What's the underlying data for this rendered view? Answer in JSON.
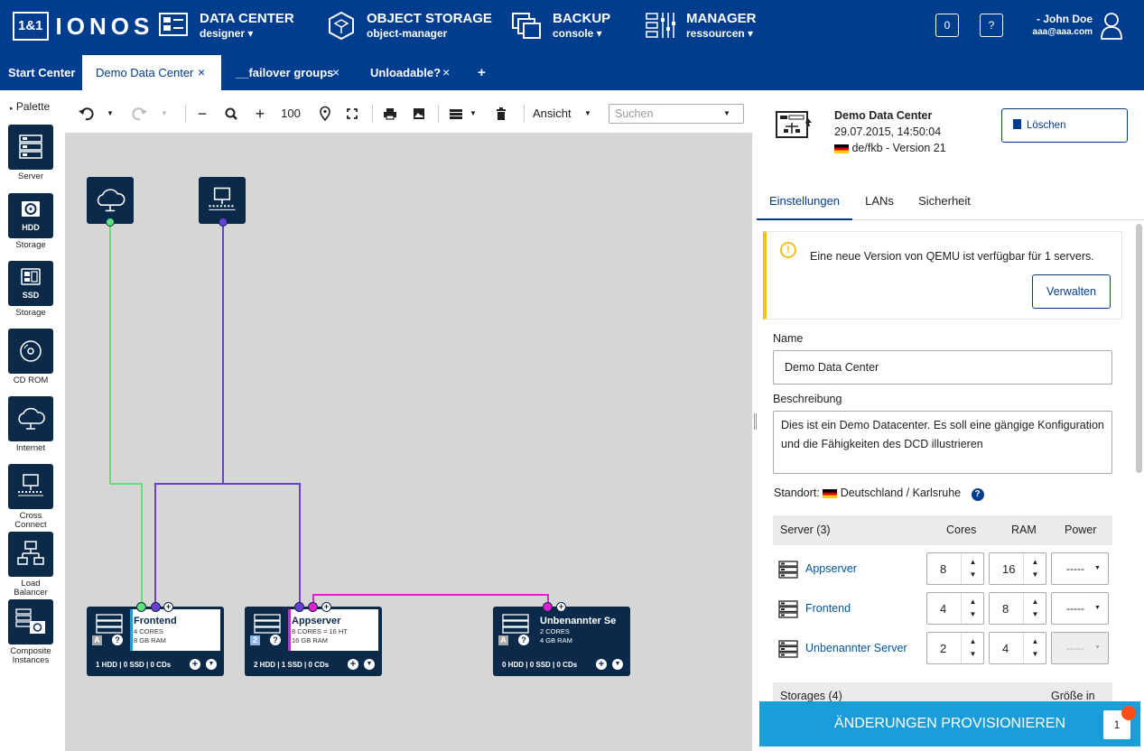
{
  "brand": {
    "box": "1&1",
    "word": "IONOS"
  },
  "nav": [
    {
      "title": "DATA CENTER",
      "sub": "designer ▾"
    },
    {
      "title": "OBJECT STORAGE",
      "sub": "object-manager"
    },
    {
      "title": "BACKUP",
      "sub": "console ▾"
    },
    {
      "title": "MANAGER",
      "sub": "ressourcen ▾"
    }
  ],
  "header": {
    "notifications": "0",
    "help": "?",
    "user_name": "John Doe",
    "user_email": "aaa@aaa.com"
  },
  "tabs": [
    {
      "label": "Start Center"
    },
    {
      "label": "Demo Data Center",
      "close": "×"
    },
    {
      "label": "__failover groups",
      "close": "×"
    },
    {
      "label": "Unloadable?",
      "close": "×"
    },
    {
      "label": "+"
    }
  ],
  "palette": {
    "title": "Palette",
    "items": [
      {
        "label": "Server",
        "badge": ""
      },
      {
        "label": "Storage",
        "badge": "HDD"
      },
      {
        "label": "Storage",
        "badge": "SSD"
      },
      {
        "label": "CD ROM",
        "badge": ""
      },
      {
        "label": "Internet",
        "badge": ""
      },
      {
        "label": "Cross Connect",
        "badge": ""
      },
      {
        "label": "Load Balancer",
        "badge": ""
      },
      {
        "label": "Composite Instances",
        "badge": ""
      }
    ]
  },
  "toolbar": {
    "zoom": "100",
    "view_label": "Ansicht",
    "search_placeholder": "Suchen"
  },
  "canvas": {
    "nodes": [
      {
        "name": "Frontend",
        "l1": "4 CORES",
        "l2": "8 GB RAM",
        "footer": "1 HDD | 0 SSD | 0 CDs",
        "badge": "A"
      },
      {
        "name": "Appserver",
        "l1": "8 CORES = 16 HT",
        "l2": "16 GB RAM",
        "footer": "2 HDD | 1 SSD | 0 CDs",
        "badge": "2"
      },
      {
        "name": "Unbenannter Se",
        "l1": "2 CORES",
        "l2": "4 GB RAM",
        "footer": "0 HDD | 0 SSD | 0 CDs",
        "badge": "A"
      }
    ],
    "help": "?"
  },
  "datacenter": {
    "name": "Demo Data Center",
    "date": "29.07.2015, 14:50:04",
    "location": "de/fkb - Version 21",
    "delete_label": "Löschen"
  },
  "rtabs": [
    "Einstellungen",
    "LANs",
    "Sicherheit"
  ],
  "alert": {
    "text": "Eine neue Version von QEMU ist verfügbar für 1 servers.",
    "button": "Verwalten"
  },
  "form": {
    "name_label": "Name",
    "name_value": "Demo Data Center",
    "desc_label": "Beschreibung",
    "desc_value": "Dies ist ein Demo Datacenter. Es soll eine gängige Konfiguration und die Fähigkeiten des DCD illustrieren",
    "standort_label": "Standort:",
    "standort_value": "Deutschland / Karlsruhe",
    "help": "?"
  },
  "servers": {
    "header": {
      "title": "Server (3)",
      "cores": "Cores",
      "ram": "RAM",
      "power": "Power"
    },
    "rows": [
      {
        "name": "Appserver",
        "cores": "8",
        "ram": "16",
        "power": "-----"
      },
      {
        "name": "Frontend",
        "cores": "4",
        "ram": "8",
        "power": "-----"
      },
      {
        "name": "Unbenannter Server",
        "cores": "2",
        "ram": "4",
        "power": "-----"
      }
    ]
  },
  "storages": {
    "title": "Storages (4)",
    "size": "Größe in GB"
  },
  "provision": {
    "label": "ÄNDERUNGEN PROVISIONIEREN",
    "count": "1"
  },
  "colors": {
    "navy": "#003d8f",
    "node": "#0b2a4a",
    "green": "#5ee07a",
    "purple": "#6a3fd6",
    "magenta": "#e020d0",
    "accent": "#1a9dd9"
  }
}
